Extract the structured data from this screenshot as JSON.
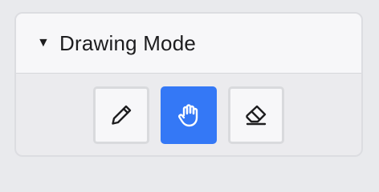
{
  "panel": {
    "caret": "▼",
    "title": "Drawing Mode",
    "expanded": true
  },
  "tools": [
    {
      "id": "pencil",
      "icon": "pencil-icon",
      "active": false
    },
    {
      "id": "pan",
      "icon": "hand-icon",
      "active": true
    },
    {
      "id": "eraser",
      "icon": "eraser-icon",
      "active": false
    }
  ],
  "colors": {
    "accent": "#3478f6",
    "icon": "#1d1d1f"
  }
}
